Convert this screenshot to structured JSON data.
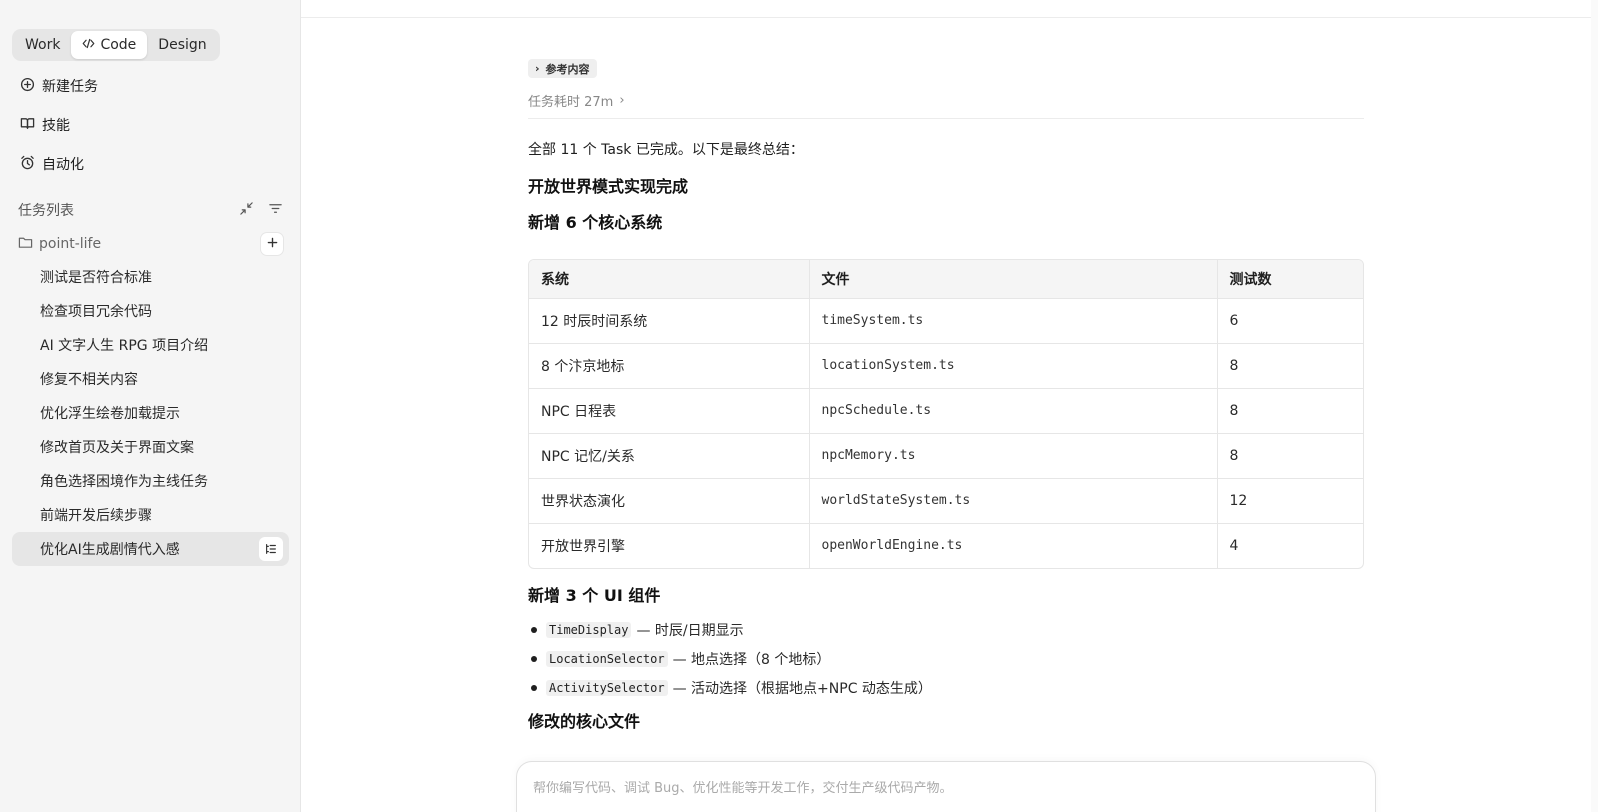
{
  "mode_switch": {
    "work": "Work",
    "code": "Code",
    "design": "Design"
  },
  "nav": {
    "new_task": "新建任务",
    "skills": "技能",
    "automation": "自动化"
  },
  "task_section": {
    "title": "任务列表"
  },
  "folder": {
    "name": "point-life"
  },
  "tasks": [
    "测试是否符合标准",
    "检查项目冗余代码",
    "AI 文字人生 RPG 项目介绍",
    "修复不相关内容",
    "优化浮生绘卷加载提示",
    "修改首页及关于界面文案",
    "角色选择困境作为主线任务",
    "前端开发后续步骤",
    "优化AI生成剧情代入感"
  ],
  "active_task_index": 8,
  "message": {
    "ref_chip": "参考内容",
    "elapsed": "任务耗时 27m",
    "intro": "全部 11 个 Task 已完成。以下是最终总结：",
    "heading_main": "开放世界模式实现完成",
    "heading_systems": "新增 6 个核心系统",
    "table": {
      "headers": [
        "系统",
        "文件",
        "测试数"
      ],
      "rows": [
        [
          "12 时辰时间系统",
          "timeSystem.ts",
          "6"
        ],
        [
          "8 个汴京地标",
          "locationSystem.ts",
          "8"
        ],
        [
          "NPC 日程表",
          "npcSchedule.ts",
          "8"
        ],
        [
          "NPC 记忆/关系",
          "npcMemory.ts",
          "8"
        ],
        [
          "世界状态演化",
          "worldStateSystem.ts",
          "12"
        ],
        [
          "开放世界引擎",
          "openWorldEngine.ts",
          "4"
        ]
      ]
    },
    "heading_ui": "新增 3 个 UI 组件",
    "ui_items": [
      {
        "code": "TimeDisplay",
        "text": "— 时辰/日期显示"
      },
      {
        "code": "LocationSelector",
        "text": "— 地点选择（8 个地标）"
      },
      {
        "code": "ActivitySelector",
        "text": "— 活动选择（根据地点+NPC 动态生成）"
      }
    ],
    "heading_files": "修改的核心文件"
  },
  "composer": {
    "placeholder": "帮你编写代码、调试 Bug、优化性能等开发工作，交付生产级代码产物。"
  }
}
